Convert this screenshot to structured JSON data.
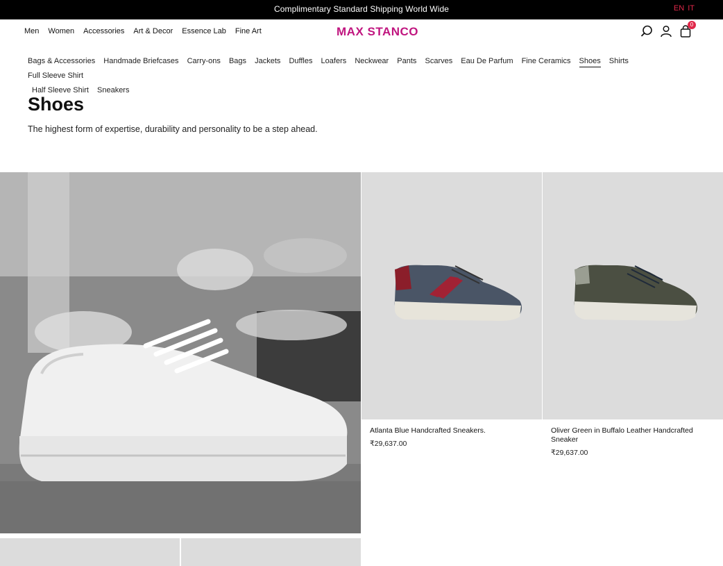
{
  "announcement": "Complimentary Standard Shipping World Wide",
  "languages": [
    "EN",
    "IT"
  ],
  "main_nav": [
    "Men",
    "Women",
    "Accessories",
    "Art & Decor",
    "Essence Lab",
    "Fine Art"
  ],
  "brand": "MAX STANCO",
  "header_icons": [
    "search-icon",
    "user-icon",
    "cart-icon"
  ],
  "cart_count": "0",
  "categories_row1": [
    "Bags & Accessories",
    "Handmade Briefcases",
    "Carry-ons",
    "Bags",
    "Jackets",
    "Duffles",
    "Loafers",
    "Neckwear",
    "Pants",
    "Scarves",
    "Eau De Parfum",
    "Fine Ceramics",
    "Shoes",
    "Shirts",
    "Full Sleeve Shirt"
  ],
  "categories_row2": [
    "Half Sleeve Shirt",
    "Sneakers"
  ],
  "active_category": "Shoes",
  "page": {
    "title": "Shoes",
    "description": "The highest form of expertise, durability and personality to be a step ahead."
  },
  "products": [
    {
      "name": "Atlanta Blue Handcrafted Sneakers.",
      "price": "₹29,637.00",
      "color": "#4a5566",
      "accent": "#8b1e2a"
    },
    {
      "name": "Oliver Green in Buffalo Leather Handcrafted Sneaker",
      "price": "₹29,637.00",
      "color": "#4b4f42",
      "accent": "#9a9e92"
    }
  ],
  "colors": {
    "brand": "#c0157f",
    "lang": "#e0284a",
    "topbar": "#000000",
    "tile": "#dcdcdc"
  }
}
